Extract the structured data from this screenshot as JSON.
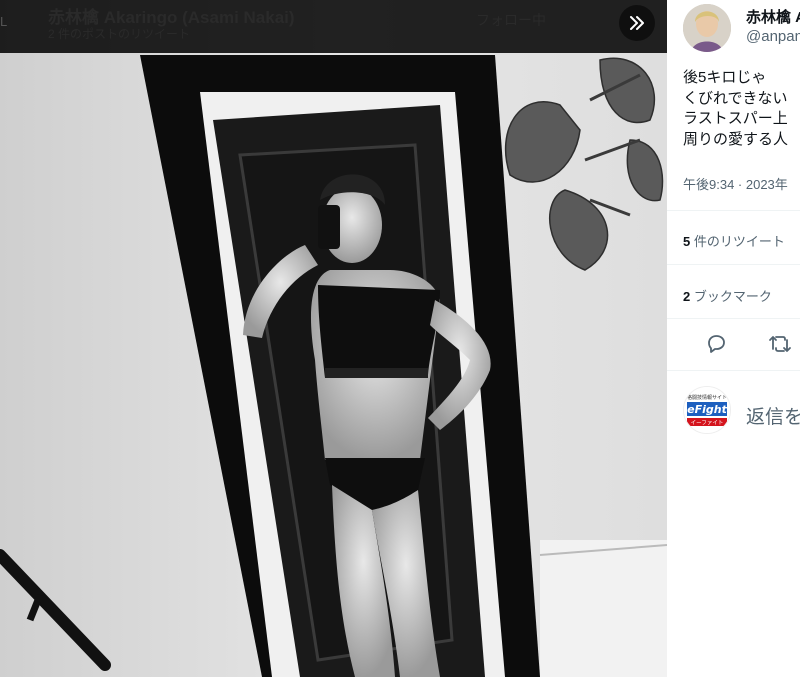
{
  "viewer": {
    "author_title": "赤林檎 Akaringo (Asami Nakai)",
    "repost_subtitle": "2 件のポストのリツイート",
    "follow_label": "フォロー中",
    "edge_label": "L",
    "expand_icon": "double-chevron-right-icon"
  },
  "tweet": {
    "author_name": "赤林檎 A",
    "author_handle": "@anpan",
    "text_lines": [
      "後5キロじゃ",
      "くびれできない",
      "ラストスパー上",
      "周りの愛する人"
    ],
    "timestamp": "午後9:34 · 2023年",
    "retweets": {
      "count": "5",
      "label": "件のリツイート"
    },
    "bookmarks": {
      "count": "2",
      "label": "ブックマーク"
    },
    "reply_placeholder": "返信を",
    "reply_avatar_logo": {
      "top": "格闘技情報サイト",
      "main": "eFight",
      "bottom": "イーファイト"
    }
  },
  "colors": {
    "panel_bg": "#ffffff",
    "muted_text": "#536471",
    "main_text": "#0f1419",
    "efight_blue": "#1d5fbf",
    "efight_red": "#d4141d"
  }
}
